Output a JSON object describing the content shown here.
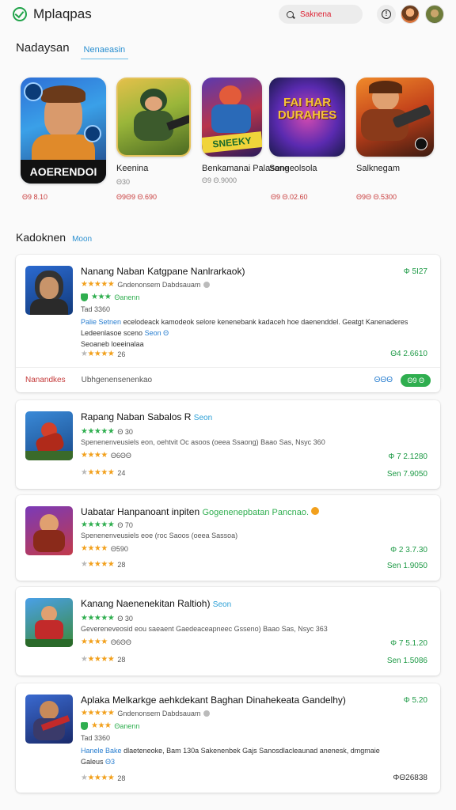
{
  "header": {
    "app_title": "Mplaqpas",
    "search_placeholder": "Saknena",
    "icons": [
      "check-circle-icon",
      "search-icon",
      "info-icon"
    ]
  },
  "tabs": {
    "main": "Nadaysan",
    "link": "Nenaeasin"
  },
  "featured": [
    {
      "name": "",
      "banner": "AOERENDOI",
      "price": "Θ9 8.10"
    },
    {
      "name": "Keenina",
      "sub": "Θ30",
      "price": "Θ9Θ9 Θ.690"
    },
    {
      "name": "Benkamanai Palasane",
      "sub": "Θ9 Θ.9000",
      "price": ""
    },
    {
      "name": "Sengeolsola",
      "banner": "FAI HAR DURAHES",
      "price": "Θ9 Θ.02.60"
    },
    {
      "name": "Salknegam",
      "price": "Θ9Θ Θ.5300"
    }
  ],
  "section": {
    "title": "Kadoknen",
    "more": "Moon"
  },
  "cards": [
    {
      "title": "Nanang Naban Katgpane Nanlrarkaok)",
      "tag": "",
      "price": "Φ 5Ι27",
      "line1": "Gndenonsem Dabdsauam",
      "line2": "Θanenn",
      "line3": "Tad 3360",
      "desc_blue": "Palie Setnen",
      "desc": "ecelodeack kamodeok selore kenenebank kadaceh hoe daenenddel.",
      "desc_tail": "Geatgt Kanenaderes Ledeenlasoe sceno",
      "desc_tail_blue": "Seon Θ",
      "desc_end": "Seoaneb loeeinalaa",
      "rating_val": "26",
      "price2": "Θ4 2.6610",
      "footer_link": "Nanandkes",
      "footer_text": "Ubhgenensenenkao",
      "footer_price": "ΘΘΘ",
      "footer_pill": "Θ9 Θ"
    },
    {
      "title": "Rapang Naban Sabalos R",
      "tag": "Seon",
      "line1": "Θ 30",
      "line2": "Spenenenveusiels eon, oehtvit Oc asoos (oeea Ssaong) Baao Sas, Nsyc 360",
      "line3": "Θ6ΘΘ",
      "rating_val": "24",
      "price": "Φ 7 2.1280",
      "price2": "Sen 7.9050"
    },
    {
      "title": "Uabatar Hanpanoant inpiten",
      "tag": "Gogenenepbatan Pancnao.",
      "line1": "Θ 70",
      "line2": "Spenenenveusiels eoe (roc Saoos (oeea Sassoa)",
      "line3": "Θ590",
      "rating_val": "28",
      "price": "Φ 2 3.7.30",
      "price2": "Sen 1.9050"
    },
    {
      "title": "Kanang Naenenekitan Raltioh)",
      "tag": "Seon",
      "line1": "Θ 30",
      "line2": "Gevereneveosid eou saeaent Gaedeaceapneec Gsseno) Baao Sas, Nsyc 363",
      "line3": "Θ6ΘΘ",
      "rating_val": "28",
      "price": "Φ 7 5.1.20",
      "price2": "Sen 1.5086"
    },
    {
      "title": "Aplaka Melkarkge aehkdekant Baghan Dinahekeata Gandelhy)",
      "tag": "",
      "price": "Φ 5.20",
      "line1": "Gndenonsem Dabdsauam",
      "line2": "Θanenn",
      "line3": "Tad 3360",
      "desc_blue": "Hanele Bake",
      "desc": "dlaeteneoke, Bam 130a Sakenenbek Gajs Sanosdlacleaunad anenesk, dmgmaie",
      "desc_end_blue": "Θ3",
      "desc_end": "Galeus",
      "rating_val": "28",
      "price2": "ΦΘ26838"
    }
  ],
  "colors": {
    "accent_green": "#2fae4f",
    "link_blue": "#2a8fd0",
    "price_red": "#c94040",
    "star_orange": "#f2a01c"
  }
}
